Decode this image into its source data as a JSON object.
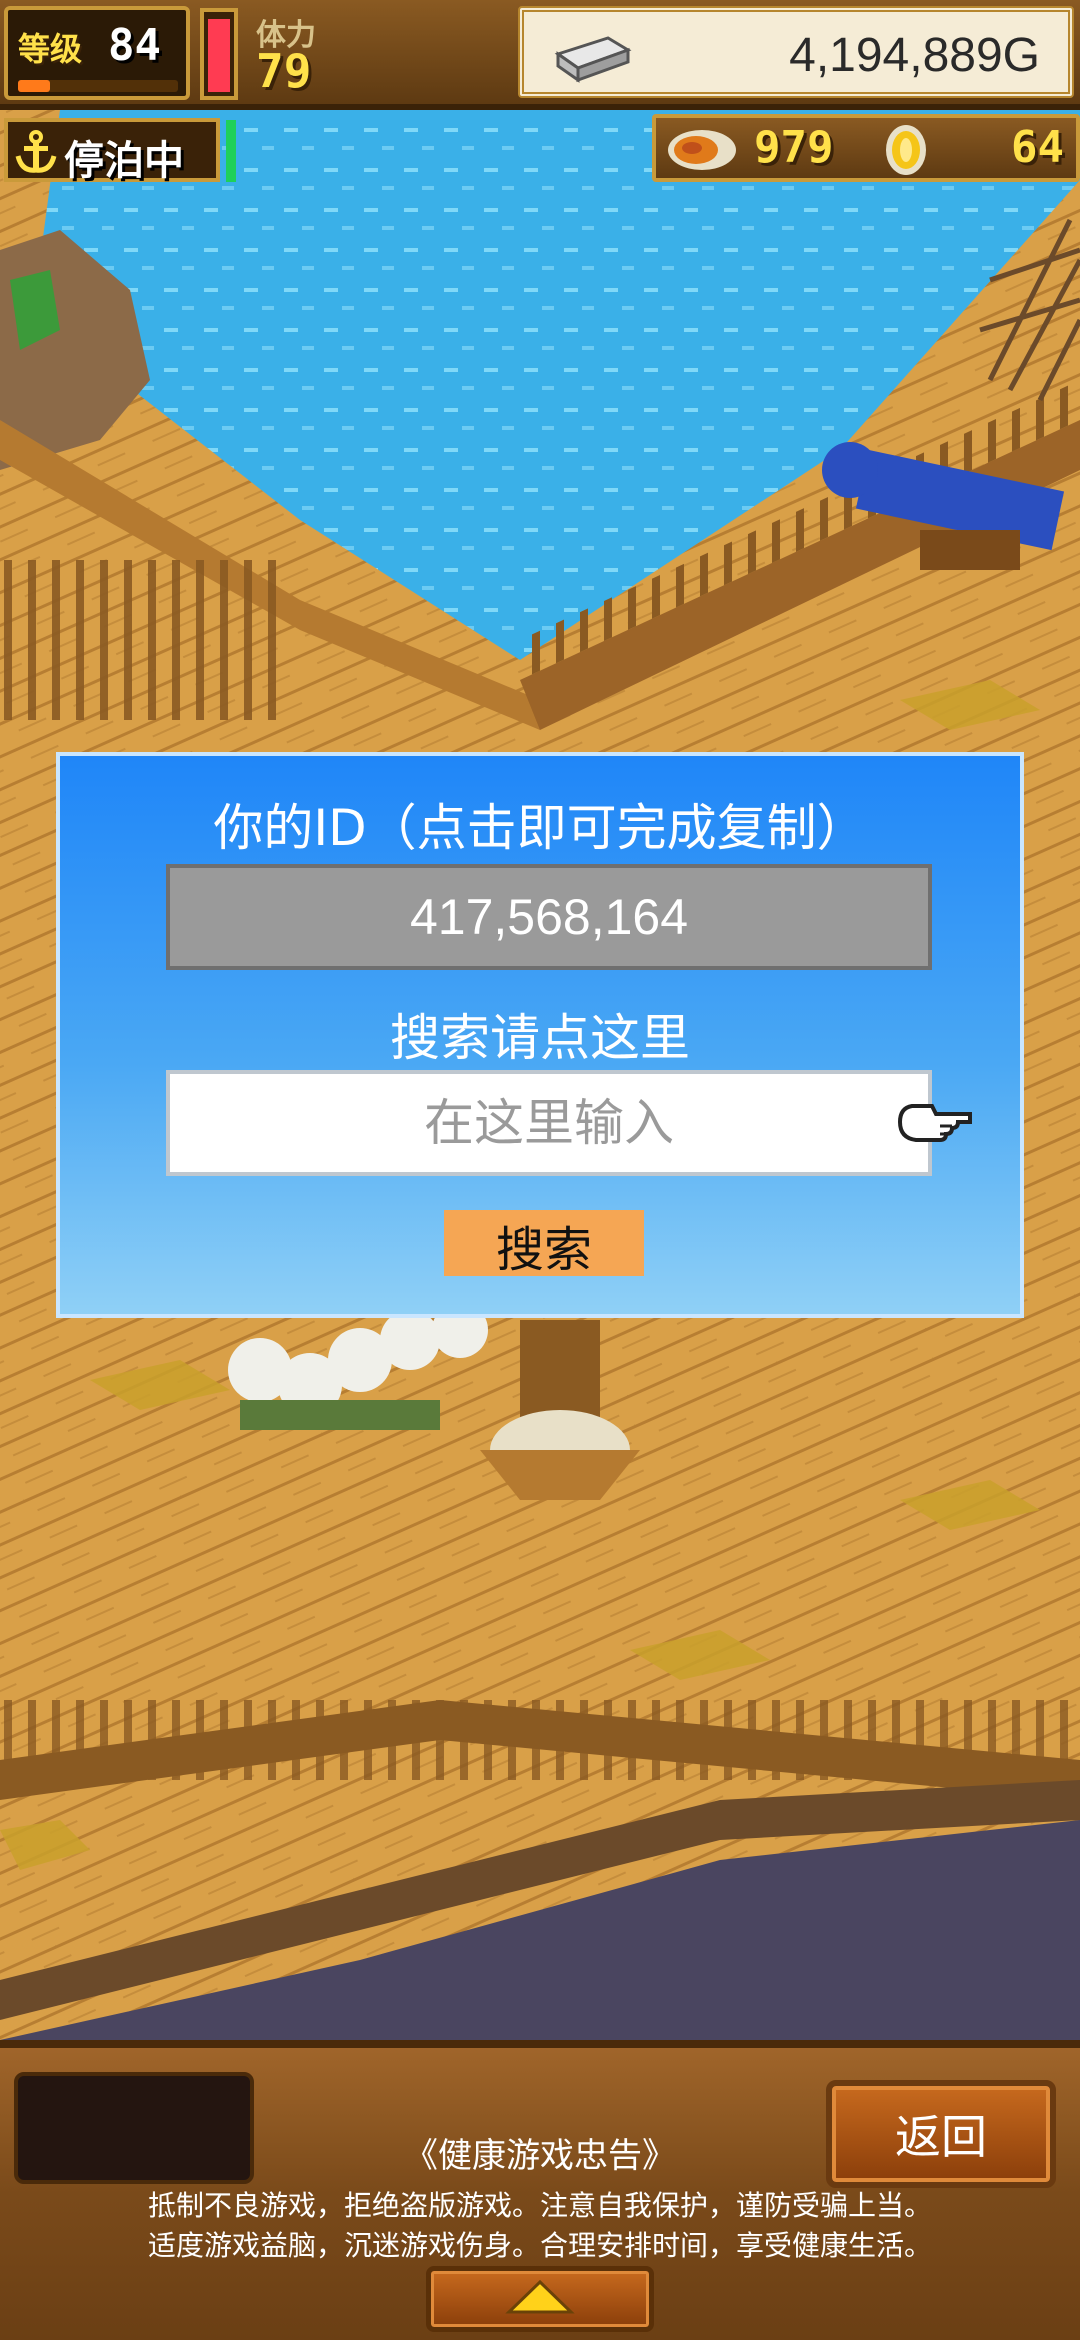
{
  "hud": {
    "level_label": "等级",
    "level_value": "84",
    "level_progress": 0.2,
    "stamina_label": "体力",
    "stamina_value": "79",
    "stamina_fill": 0.97,
    "gold_value": "4,194,889G",
    "status_label": "停泊中",
    "bait_value": "979",
    "coin_value": "64",
    "icons": [
      "silver-bar-icon",
      "anchor-icon",
      "bait-icon",
      "gold-coin-icon"
    ]
  },
  "dialog": {
    "title": "你的ID（点击即可完成复制）",
    "id_value": "417,568,164",
    "search_hint": "搜索请点这里",
    "search_placeholder": "在这里输入",
    "search_button": "搜索",
    "pointer_icon": "pointing-hand-icon"
  },
  "bottom": {
    "back_button": "返回",
    "health_title": "《健康游戏忠告》",
    "health_line_1": "抵制不良游戏，拒绝盗版游戏。注意自我保护，谨防受骗上当。",
    "health_line_2": "适度游戏益脑，沉迷游戏伤身。合理安排时间，享受健康生活。",
    "expand_icon": "triangle-up-icon"
  },
  "colors": {
    "dialog_top": "#1f86f8",
    "dialog_bottom": "#8fd0f6",
    "search_button": "#f5a654",
    "gold_text": "#ffe14a",
    "stamina": "#ff3b52"
  }
}
